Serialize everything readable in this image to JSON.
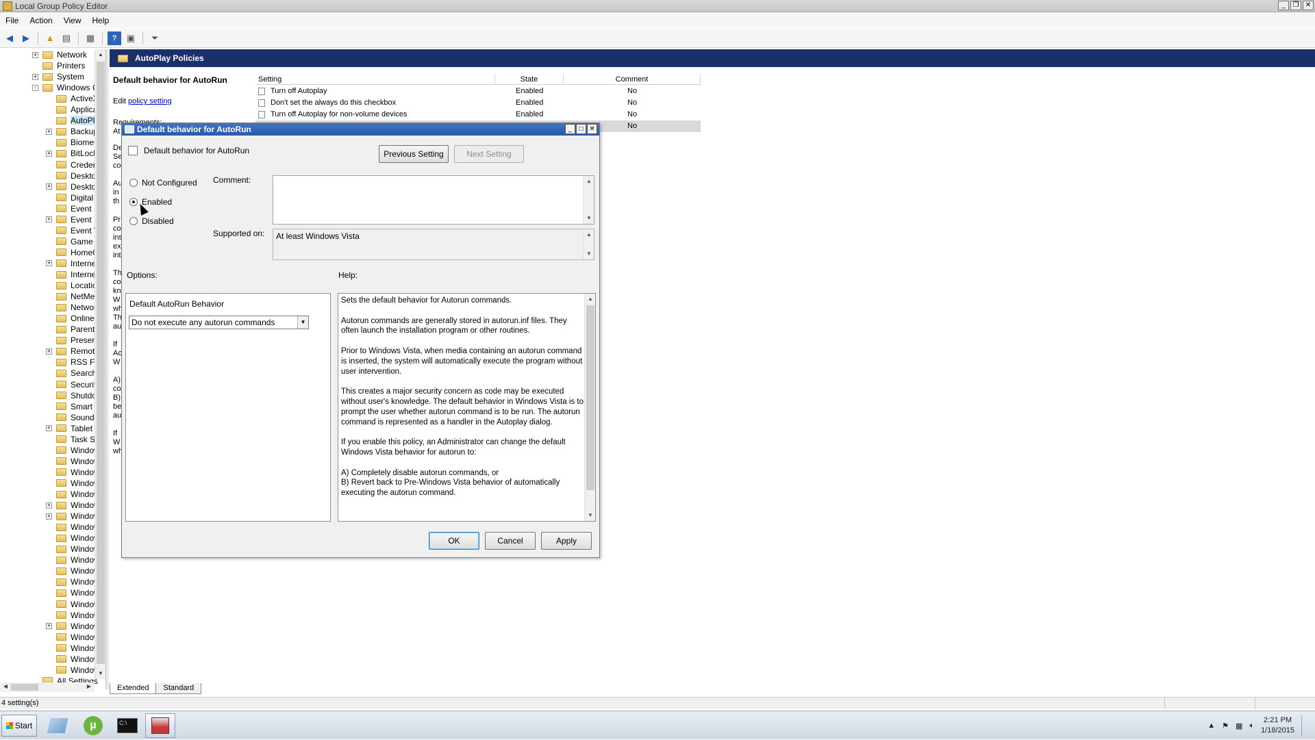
{
  "window": {
    "title": "Local Group Policy Editor"
  },
  "menu": [
    "File",
    "Action",
    "View",
    "Help"
  ],
  "tree": {
    "items": [
      {
        "label": "Network",
        "expander": "+"
      },
      {
        "label": "Printers",
        "expander": ""
      },
      {
        "label": "System",
        "expander": "+"
      },
      {
        "label": "Windows Co",
        "expander": "-"
      },
      {
        "label": "ActiveX",
        "expander": ""
      },
      {
        "label": "Applicat",
        "expander": ""
      },
      {
        "label": "AutoPla",
        "expander": "",
        "selected": true
      },
      {
        "label": "Backup",
        "expander": "+"
      },
      {
        "label": "Biometr",
        "expander": ""
      },
      {
        "label": "BitLocke",
        "expander": "+"
      },
      {
        "label": "Creden",
        "expander": ""
      },
      {
        "label": "Desktop",
        "expander": ""
      },
      {
        "label": "Desktop",
        "expander": "+"
      },
      {
        "label": "Digital L",
        "expander": ""
      },
      {
        "label": "Event F",
        "expander": ""
      },
      {
        "label": "Event L",
        "expander": "+"
      },
      {
        "label": "Event V",
        "expander": ""
      },
      {
        "label": "Game E",
        "expander": ""
      },
      {
        "label": "HomeGr",
        "expander": ""
      },
      {
        "label": "Interne",
        "expander": "+"
      },
      {
        "label": "Interne",
        "expander": ""
      },
      {
        "label": "Locatior",
        "expander": ""
      },
      {
        "label": "NetMee",
        "expander": ""
      },
      {
        "label": "Networl",
        "expander": ""
      },
      {
        "label": "Online A",
        "expander": ""
      },
      {
        "label": "Parenta",
        "expander": ""
      },
      {
        "label": "Present",
        "expander": ""
      },
      {
        "label": "Remote",
        "expander": "+"
      },
      {
        "label": "RSS Fee",
        "expander": ""
      },
      {
        "label": "Search",
        "expander": ""
      },
      {
        "label": "Security",
        "expander": ""
      },
      {
        "label": "Shutdov",
        "expander": ""
      },
      {
        "label": "Smart C",
        "expander": ""
      },
      {
        "label": "Sound F",
        "expander": ""
      },
      {
        "label": "Tablet F",
        "expander": "+"
      },
      {
        "label": "Task Sc",
        "expander": ""
      },
      {
        "label": "Window",
        "expander": ""
      },
      {
        "label": "Window",
        "expander": ""
      },
      {
        "label": "Window",
        "expander": ""
      },
      {
        "label": "Window",
        "expander": ""
      },
      {
        "label": "Window",
        "expander": ""
      },
      {
        "label": "Window",
        "expander": "+"
      },
      {
        "label": "Window",
        "expander": "+"
      },
      {
        "label": "Window",
        "expander": ""
      },
      {
        "label": "Window",
        "expander": ""
      },
      {
        "label": "Window",
        "expander": ""
      },
      {
        "label": "Window",
        "expander": ""
      },
      {
        "label": "Window",
        "expander": ""
      },
      {
        "label": "Window",
        "expander": ""
      },
      {
        "label": "Window",
        "expander": ""
      },
      {
        "label": "Window",
        "expander": ""
      },
      {
        "label": "Window",
        "expander": ""
      },
      {
        "label": "Window",
        "expander": "+"
      },
      {
        "label": "Window",
        "expander": ""
      },
      {
        "label": "Window",
        "expander": ""
      },
      {
        "label": "Window",
        "expander": ""
      },
      {
        "label": "Window",
        "expander": ""
      },
      {
        "label": "All Settings",
        "expander": ""
      }
    ]
  },
  "right": {
    "header": "AutoPlay Policies",
    "desc_title": "Default behavior for AutoRun",
    "edit_prefix": "Edit ",
    "edit_link": "policy setting",
    "requirements": "Requirements:",
    "fragments": [
      "At",
      "De",
      "Se",
      "co",
      "Au",
      "in",
      "th",
      "Pr",
      "co",
      "ins",
      "ex",
      "int",
      "Th",
      "co",
      "kn",
      "W",
      "wh",
      "Th",
      "au",
      "If",
      "Ac",
      "W",
      "A)",
      "co",
      "B)",
      "be",
      "au",
      "If",
      "W",
      "wh"
    ],
    "columns": {
      "setting": "Setting",
      "state": "State",
      "comment": "Comment"
    },
    "rows": [
      {
        "setting": "Turn off Autoplay",
        "state": "Enabled",
        "comment": "No"
      },
      {
        "setting": "Don't set the always do this checkbox",
        "state": "Enabled",
        "comment": "No"
      },
      {
        "setting": "Turn off Autoplay for non-volume devices",
        "state": "Enabled",
        "comment": "No"
      },
      {
        "setting": "",
        "state": "",
        "comment": "No"
      }
    ],
    "tabs": [
      "Extended",
      "Standard"
    ]
  },
  "status": "4 setting(s)",
  "dialog": {
    "title": "Default behavior for AutoRun",
    "policy_name": "Default behavior for AutoRun",
    "prev_button": "Previous Setting",
    "next_button": "Next Setting",
    "radio": {
      "not_configured": "Not Configured",
      "enabled": "Enabled",
      "disabled": "Disabled",
      "selected": "enabled"
    },
    "comment_label": "Comment:",
    "comment_value": "",
    "supported_label": "Supported on:",
    "supported_value": "At least Windows Vista",
    "options_label": "Options:",
    "help_label": "Help:",
    "option_title": "Default AutoRun Behavior",
    "option_select": "Do not execute any autorun commands",
    "help_paragraphs": [
      "Sets the default behavior for Autorun commands.",
      "Autorun commands are generally stored in autorun.inf files. They often launch the installation program or other routines.",
      "Prior to Windows Vista, when media containing an autorun command is inserted, the system will automatically execute the program without user intervention.",
      "This creates a major security concern as code may be executed without user's knowledge. The default behavior in Windows Vista is to prompt the user whether autorun command is to be run. The autorun command is represented as a handler in the Autoplay dialog.",
      "If you enable this policy, an Administrator can change the default Windows Vista behavior for autorun to:",
      "A) Completely disable autorun commands, or\nB) Revert back to Pre-Windows Vista behavior of automatically executing the autorun command."
    ],
    "ok": "OK",
    "cancel": "Cancel",
    "apply": "Apply"
  },
  "taskbar": {
    "start": "Start",
    "time": "2:21 PM",
    "date": "1/18/2015"
  }
}
